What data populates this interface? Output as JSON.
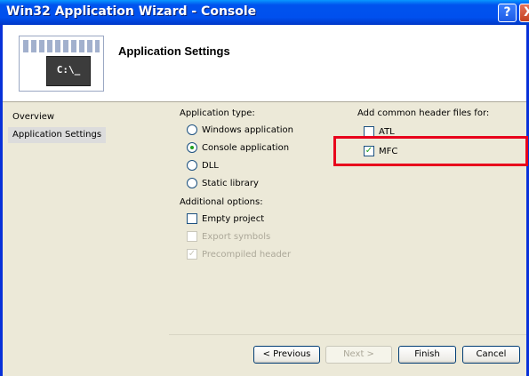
{
  "window": {
    "title": "Win32 Application Wizard - Console",
    "help_glyph": "?",
    "close_glyph": "X"
  },
  "header": {
    "heading": "Application Settings",
    "logo_text": "C:\\_"
  },
  "sidebar": {
    "items": [
      {
        "label": "Overview",
        "selected": false
      },
      {
        "label": "Application Settings",
        "selected": true
      }
    ]
  },
  "app_type": {
    "label": "Application type:",
    "options": [
      {
        "label": "Windows application",
        "checked": false
      },
      {
        "label": "Console application",
        "checked": true
      },
      {
        "label": "DLL",
        "checked": false
      },
      {
        "label": "Static library",
        "checked": false
      }
    ]
  },
  "additional": {
    "label": "Additional options:",
    "options": [
      {
        "label": "Empty project",
        "checked": false,
        "disabled": false
      },
      {
        "label": "Export symbols",
        "checked": false,
        "disabled": true
      },
      {
        "label": "Precompiled header",
        "checked": true,
        "disabled": true
      }
    ]
  },
  "headers": {
    "label": "Add common header files for:",
    "options": [
      {
        "label": "ATL",
        "checked": false
      },
      {
        "label": "MFC",
        "checked": true
      }
    ]
  },
  "buttons": {
    "previous": "< Previous",
    "next": "Next >",
    "finish": "Finish",
    "cancel": "Cancel"
  },
  "colors": {
    "highlight": "#e8001c",
    "titlebar": "#0050ee"
  }
}
